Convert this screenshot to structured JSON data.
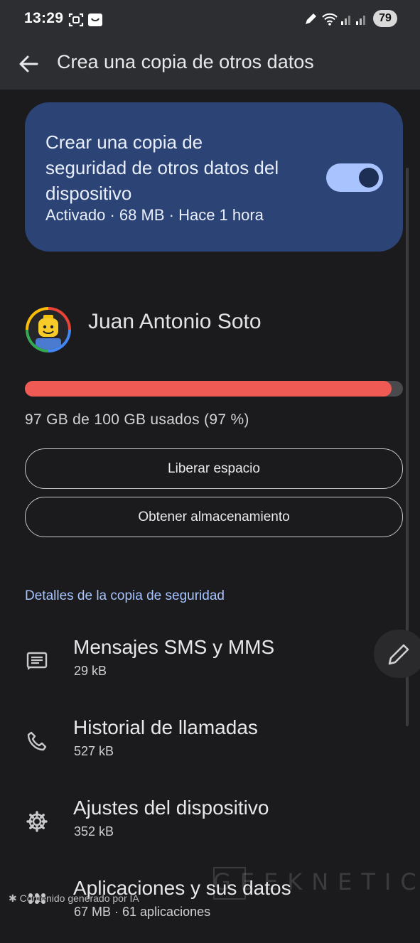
{
  "status_bar": {
    "time": "13:29",
    "battery": "79"
  },
  "app_bar": {
    "title": "Crea una copia de otros datos"
  },
  "backup_card": {
    "title": "Crear una copia de seguridad de otros datos del dispositivo",
    "subtitle": "Activado · 68 MB · Hace 1 hora",
    "toggle_on": true,
    "background": "#2b4375",
    "toggle_color": "#a9c3ff"
  },
  "account": {
    "name": "Juan Antonio Soto"
  },
  "storage": {
    "used_fraction": 0.97,
    "text": "97 GB de 100 GB usados (97 %)",
    "fill_color": "#ef5a55"
  },
  "buttons": {
    "free_space": "Liberar espacio",
    "get_storage": "Obtener almacenamiento"
  },
  "details": {
    "section_title": "Detalles de la copia de seguridad",
    "items": [
      {
        "icon": "message-icon",
        "title": "Mensajes SMS y MMS",
        "size": "29 kB"
      },
      {
        "icon": "phone-icon",
        "title": "Historial de llamadas",
        "size": "527 kB"
      },
      {
        "icon": "gear-icon",
        "title": "Ajustes del dispositivo",
        "size": "352 kB"
      },
      {
        "icon": "apps-grid-icon",
        "title": "Aplicaciones y sus datos",
        "size": "67 MB · 61 aplicaciones"
      }
    ]
  },
  "overlay": {
    "ai_label": "Contenido generado por IA",
    "watermark": "GEEKNETIC"
  }
}
